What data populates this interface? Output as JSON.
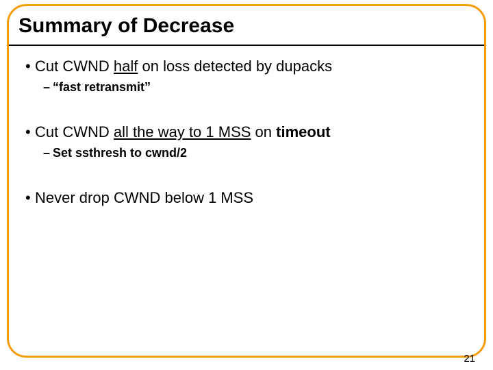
{
  "title": "Summary of Decrease",
  "bullets": {
    "b1": {
      "pre": "Cut CWND ",
      "u": "half",
      "post": " on loss detected by dupacks",
      "sub_pre": "“",
      "sub_main": "fast retransmit",
      "sub_post": "”"
    },
    "b2": {
      "pre": "Cut CWND ",
      "u": "all the way to 1 MSS",
      "mid": " on ",
      "bold": "timeout",
      "sub": "Set ssthresh to cwnd/2"
    },
    "b3": {
      "text": "Never drop CWND below 1 MSS"
    }
  },
  "page_number": "21"
}
